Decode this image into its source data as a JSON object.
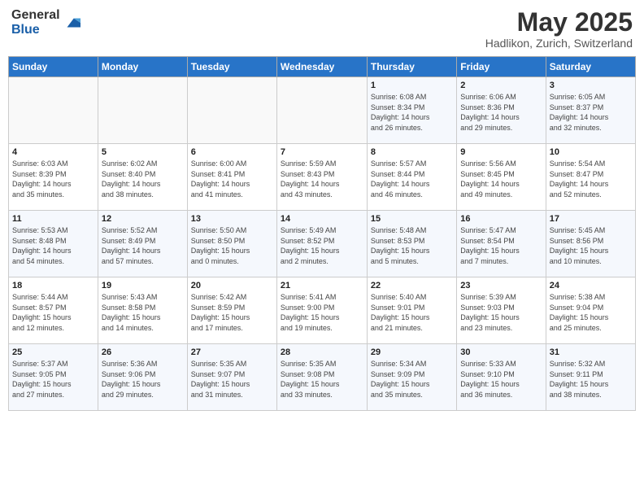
{
  "header": {
    "logo_general": "General",
    "logo_blue": "Blue",
    "title": "May 2025",
    "subtitle": "Hadlikon, Zurich, Switzerland"
  },
  "weekdays": [
    "Sunday",
    "Monday",
    "Tuesday",
    "Wednesday",
    "Thursday",
    "Friday",
    "Saturday"
  ],
  "weeks": [
    [
      {
        "day": "",
        "info": ""
      },
      {
        "day": "",
        "info": ""
      },
      {
        "day": "",
        "info": ""
      },
      {
        "day": "",
        "info": ""
      },
      {
        "day": "1",
        "info": "Sunrise: 6:08 AM\nSunset: 8:34 PM\nDaylight: 14 hours\nand 26 minutes."
      },
      {
        "day": "2",
        "info": "Sunrise: 6:06 AM\nSunset: 8:36 PM\nDaylight: 14 hours\nand 29 minutes."
      },
      {
        "day": "3",
        "info": "Sunrise: 6:05 AM\nSunset: 8:37 PM\nDaylight: 14 hours\nand 32 minutes."
      }
    ],
    [
      {
        "day": "4",
        "info": "Sunrise: 6:03 AM\nSunset: 8:39 PM\nDaylight: 14 hours\nand 35 minutes."
      },
      {
        "day": "5",
        "info": "Sunrise: 6:02 AM\nSunset: 8:40 PM\nDaylight: 14 hours\nand 38 minutes."
      },
      {
        "day": "6",
        "info": "Sunrise: 6:00 AM\nSunset: 8:41 PM\nDaylight: 14 hours\nand 41 minutes."
      },
      {
        "day": "7",
        "info": "Sunrise: 5:59 AM\nSunset: 8:43 PM\nDaylight: 14 hours\nand 43 minutes."
      },
      {
        "day": "8",
        "info": "Sunrise: 5:57 AM\nSunset: 8:44 PM\nDaylight: 14 hours\nand 46 minutes."
      },
      {
        "day": "9",
        "info": "Sunrise: 5:56 AM\nSunset: 8:45 PM\nDaylight: 14 hours\nand 49 minutes."
      },
      {
        "day": "10",
        "info": "Sunrise: 5:54 AM\nSunset: 8:47 PM\nDaylight: 14 hours\nand 52 minutes."
      }
    ],
    [
      {
        "day": "11",
        "info": "Sunrise: 5:53 AM\nSunset: 8:48 PM\nDaylight: 14 hours\nand 54 minutes."
      },
      {
        "day": "12",
        "info": "Sunrise: 5:52 AM\nSunset: 8:49 PM\nDaylight: 14 hours\nand 57 minutes."
      },
      {
        "day": "13",
        "info": "Sunrise: 5:50 AM\nSunset: 8:50 PM\nDaylight: 15 hours\nand 0 minutes."
      },
      {
        "day": "14",
        "info": "Sunrise: 5:49 AM\nSunset: 8:52 PM\nDaylight: 15 hours\nand 2 minutes."
      },
      {
        "day": "15",
        "info": "Sunrise: 5:48 AM\nSunset: 8:53 PM\nDaylight: 15 hours\nand 5 minutes."
      },
      {
        "day": "16",
        "info": "Sunrise: 5:47 AM\nSunset: 8:54 PM\nDaylight: 15 hours\nand 7 minutes."
      },
      {
        "day": "17",
        "info": "Sunrise: 5:45 AM\nSunset: 8:56 PM\nDaylight: 15 hours\nand 10 minutes."
      }
    ],
    [
      {
        "day": "18",
        "info": "Sunrise: 5:44 AM\nSunset: 8:57 PM\nDaylight: 15 hours\nand 12 minutes."
      },
      {
        "day": "19",
        "info": "Sunrise: 5:43 AM\nSunset: 8:58 PM\nDaylight: 15 hours\nand 14 minutes."
      },
      {
        "day": "20",
        "info": "Sunrise: 5:42 AM\nSunset: 8:59 PM\nDaylight: 15 hours\nand 17 minutes."
      },
      {
        "day": "21",
        "info": "Sunrise: 5:41 AM\nSunset: 9:00 PM\nDaylight: 15 hours\nand 19 minutes."
      },
      {
        "day": "22",
        "info": "Sunrise: 5:40 AM\nSunset: 9:01 PM\nDaylight: 15 hours\nand 21 minutes."
      },
      {
        "day": "23",
        "info": "Sunrise: 5:39 AM\nSunset: 9:03 PM\nDaylight: 15 hours\nand 23 minutes."
      },
      {
        "day": "24",
        "info": "Sunrise: 5:38 AM\nSunset: 9:04 PM\nDaylight: 15 hours\nand 25 minutes."
      }
    ],
    [
      {
        "day": "25",
        "info": "Sunrise: 5:37 AM\nSunset: 9:05 PM\nDaylight: 15 hours\nand 27 minutes."
      },
      {
        "day": "26",
        "info": "Sunrise: 5:36 AM\nSunset: 9:06 PM\nDaylight: 15 hours\nand 29 minutes."
      },
      {
        "day": "27",
        "info": "Sunrise: 5:35 AM\nSunset: 9:07 PM\nDaylight: 15 hours\nand 31 minutes."
      },
      {
        "day": "28",
        "info": "Sunrise: 5:35 AM\nSunset: 9:08 PM\nDaylight: 15 hours\nand 33 minutes."
      },
      {
        "day": "29",
        "info": "Sunrise: 5:34 AM\nSunset: 9:09 PM\nDaylight: 15 hours\nand 35 minutes."
      },
      {
        "day": "30",
        "info": "Sunrise: 5:33 AM\nSunset: 9:10 PM\nDaylight: 15 hours\nand 36 minutes."
      },
      {
        "day": "31",
        "info": "Sunrise: 5:32 AM\nSunset: 9:11 PM\nDaylight: 15 hours\nand 38 minutes."
      }
    ]
  ]
}
